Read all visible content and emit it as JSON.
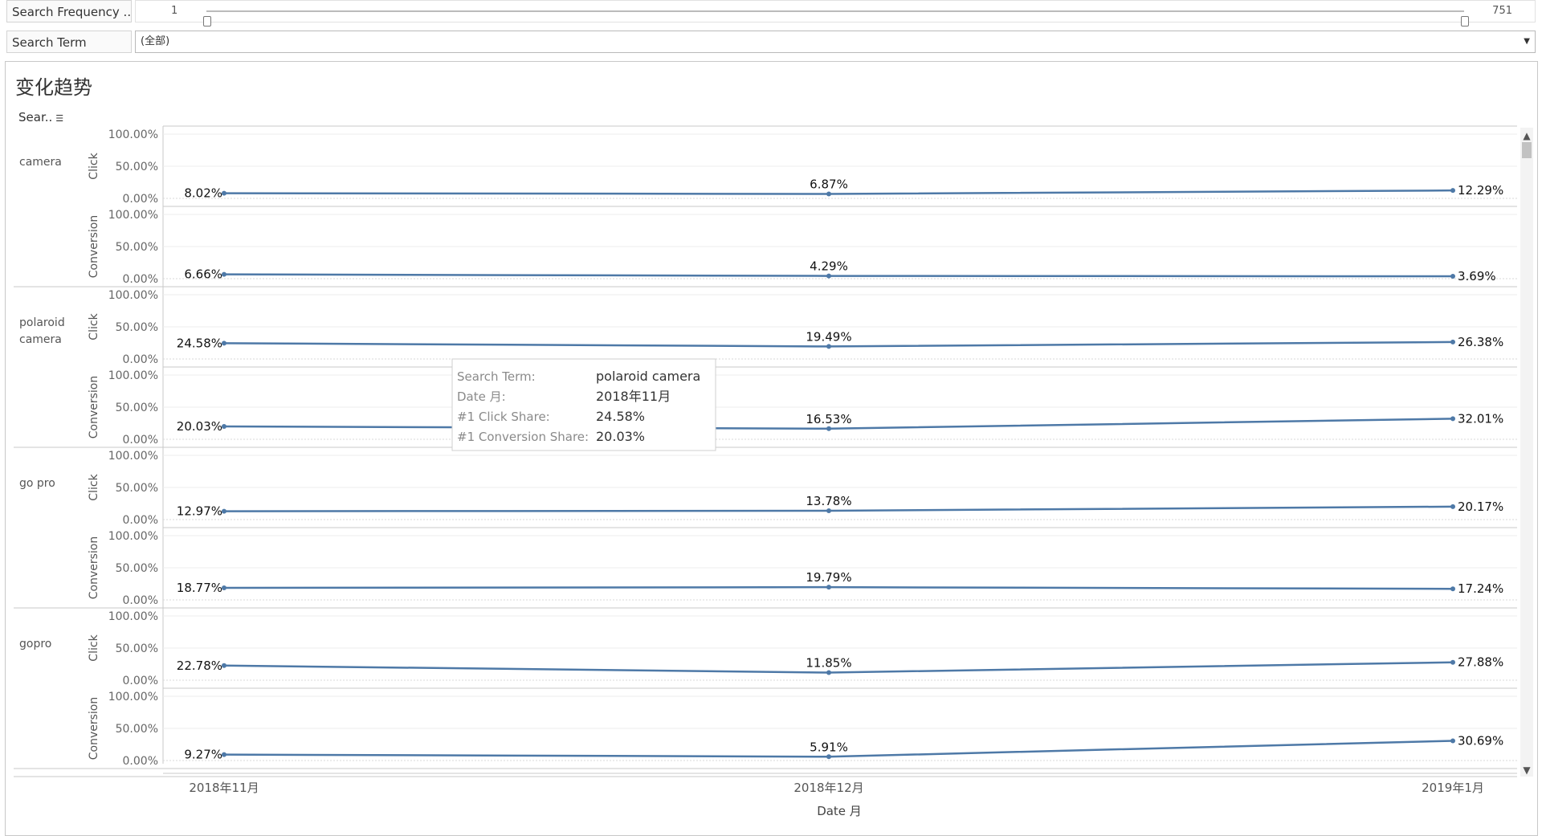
{
  "filters": {
    "frequency": {
      "label": "Search Frequency ...",
      "min": "1",
      "max": "751",
      "low": 0,
      "high": 1
    },
    "term": {
      "label": "Search Term",
      "value": "(全部)"
    }
  },
  "panel": {
    "title": "变化趋势",
    "header_label": "Sear..",
    "sort_icon": "sort-icon"
  },
  "colors": {
    "line": "#4e79a7",
    "grid": "#ececec",
    "divider": "#c8c8c8"
  },
  "chart_data": {
    "type": "line",
    "x": [
      "2018年11月",
      "2018年12月",
      "2019年1月"
    ],
    "xlabel": "Date 月",
    "ylim": [
      0,
      1
    ],
    "yticks": [
      "100.00%",
      "50.00%",
      "0.00%"
    ],
    "measures": [
      "Click",
      "Conversion"
    ],
    "rows": [
      {
        "term": "camera",
        "Click": [
          0.0802,
          0.0687,
          0.1229
        ],
        "Click_labels": [
          "8.02%",
          "6.87%",
          "12.29%"
        ],
        "Conversion": [
          0.0666,
          0.0429,
          0.0369
        ],
        "Conversion_labels": [
          "6.66%",
          "4.29%",
          "3.69%"
        ]
      },
      {
        "term": "polaroid camera",
        "Click": [
          0.2458,
          0.1949,
          0.2638
        ],
        "Click_labels": [
          "24.58%",
          "19.49%",
          "26.38%"
        ],
        "Conversion": [
          0.2003,
          0.1653,
          0.3201
        ],
        "Conversion_labels": [
          "20.03%",
          "16.53%",
          "32.01%"
        ]
      },
      {
        "term": "go pro",
        "Click": [
          0.1297,
          0.1378,
          0.2017
        ],
        "Click_labels": [
          "12.97%",
          "13.78%",
          "20.17%"
        ],
        "Conversion": [
          0.1877,
          0.1979,
          0.1724
        ],
        "Conversion_labels": [
          "18.77%",
          "19.79%",
          "17.24%"
        ]
      },
      {
        "term": "gopro",
        "Click": [
          0.2278,
          0.1185,
          0.2788
        ],
        "Click_labels": [
          "22.78%",
          "11.85%",
          "27.88%"
        ],
        "Conversion": [
          0.0927,
          0.0591,
          0.3069
        ],
        "Conversion_labels": [
          "9.27%",
          "5.91%",
          "30.69%"
        ]
      }
    ],
    "tooltip": {
      "rows": [
        {
          "k": "Search Term:",
          "v": "polaroid camera"
        },
        {
          "k": "Date 月:",
          "v": "2018年11月"
        },
        {
          "k": "#1 Click Share:",
          "v": "24.58%"
        },
        {
          "k": "#1 Conversion Share:",
          "v": "20.03%"
        }
      ]
    }
  }
}
